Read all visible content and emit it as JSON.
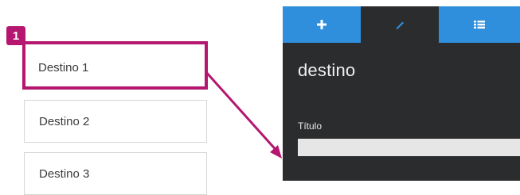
{
  "annotation": {
    "step_number": "1",
    "accent_color": "#b5166f"
  },
  "destinations": [
    {
      "label": "Destino 1"
    },
    {
      "label": "Destino 2"
    },
    {
      "label": "Destino 3"
    }
  ],
  "editor": {
    "tabs": [
      {
        "icon": "plus-icon"
      },
      {
        "icon": "pencil-icon",
        "active": true
      },
      {
        "icon": "list-icon"
      }
    ],
    "title": "destino",
    "field_label": "Título",
    "field_value": "",
    "tab_color": "#2f8fdd",
    "panel_color": "#2b2c2e"
  }
}
